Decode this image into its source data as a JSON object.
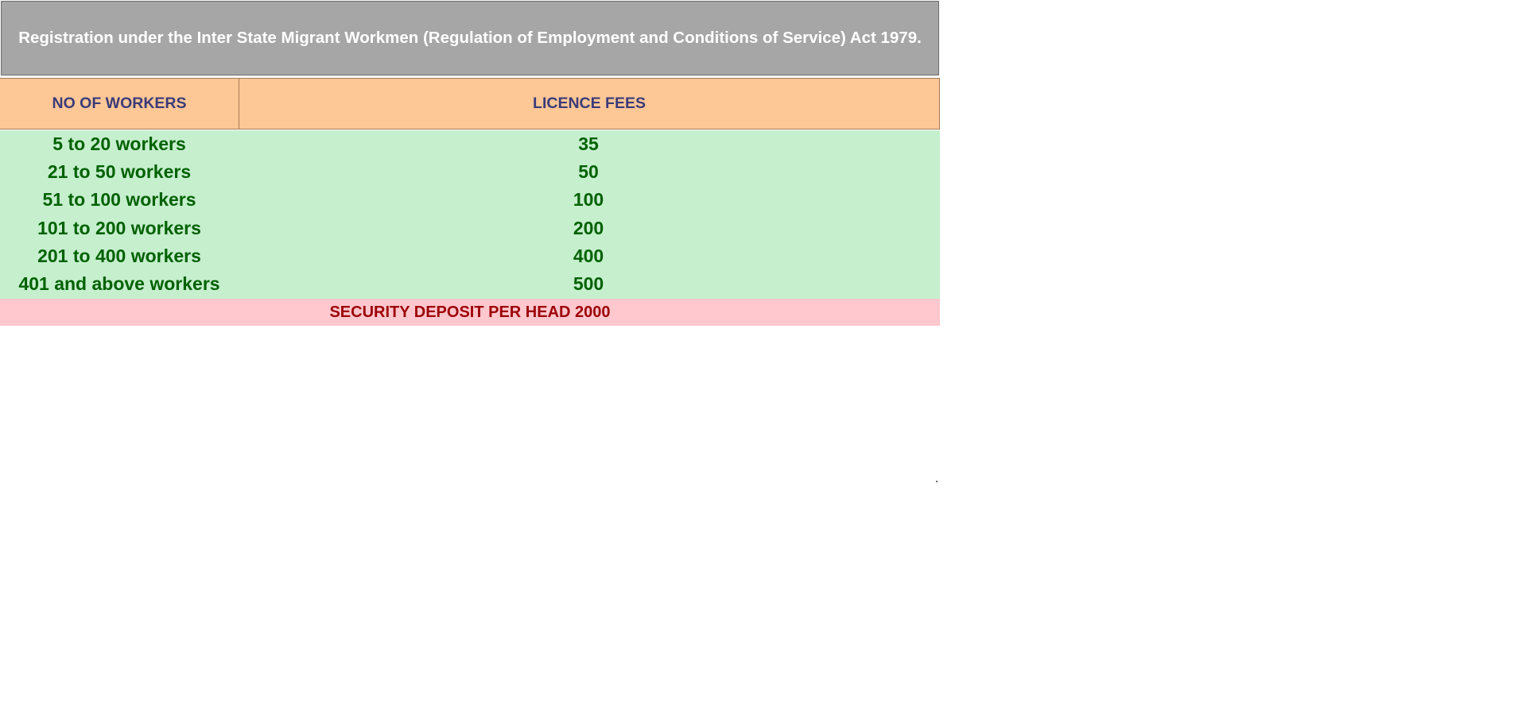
{
  "title": "Registration under the Inter State Migrant Workmen (Regulation of Employment and Conditions of Service) Act 1979.",
  "columns": {
    "workers": "NO OF WORKERS",
    "fees": "LICENCE FEES"
  },
  "rows": [
    {
      "workers": "5 to 20 workers",
      "fee": "35"
    },
    {
      "workers": "21 to 50 workers",
      "fee": "50"
    },
    {
      "workers": "51 to 100 workers",
      "fee": "100"
    },
    {
      "workers": "101 to 200 workers",
      "fee": "200"
    },
    {
      "workers": "201 to 400 workers",
      "fee": "400"
    },
    {
      "workers": "401 and above workers",
      "fee": "500"
    }
  ],
  "footer": "SECURITY DEPOSIT PER HEAD 2000",
  "colors": {
    "title_bg": "#a6a6a6",
    "header_bg": "#fdc796",
    "data_bg": "#c6efce",
    "data_text": "#006100",
    "footer_bg": "#ffc7ce",
    "footer_text": "#9c0006"
  }
}
